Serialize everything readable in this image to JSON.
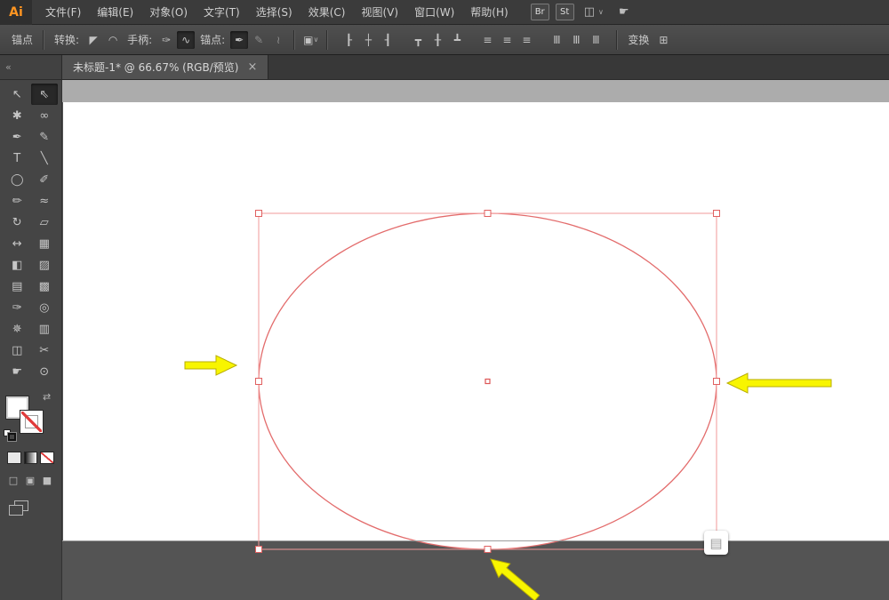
{
  "colors": {
    "arrow_yellow": "#f8f500",
    "selection_red": "#e36c6c",
    "bbox_pink": "#f29a9a",
    "artboard_bg": "#ffffff",
    "pasteboard_top": "#acacac",
    "pasteboard_bottom": "#545454",
    "ui_menubar": "#3b3b3b",
    "ui_controlbar": "#484848",
    "ui_toolbar": "#454545",
    "logo_orange": "#ff9521"
  },
  "app": {
    "logo": "Ai",
    "menus": [
      "文件(F)",
      "编辑(E)",
      "对象(O)",
      "文字(T)",
      "选择(S)",
      "效果(C)",
      "视图(V)",
      "窗口(W)",
      "帮助(H)"
    ],
    "badges": [
      "Br",
      "St"
    ],
    "workspace_glyph": "◫",
    "chevron_glyph": "∨",
    "hand_glyph": "☛"
  },
  "control": {
    "tool_label": "锚点",
    "convert_label": "转换:",
    "convert_icons": [
      "◤",
      "◠"
    ],
    "handles_label": "手柄:",
    "handle_icons": [
      "✑",
      "∿"
    ],
    "anchors_label": "锚点:",
    "anchor_icons": [
      "✒",
      "✎",
      "≀"
    ],
    "artboard_glyph": "▣",
    "align_icons": [
      "┠",
      "┼",
      "┨",
      "┳",
      "╂",
      "┻",
      "≡",
      "≡",
      "≡",
      "Ⅲ",
      "Ⅲ",
      "Ⅲ"
    ],
    "transform_label": "变换",
    "constrain_glyph": "⊞"
  },
  "tabbar": {
    "collapse_glyph": "«",
    "tab_title": "未标题-1* @ 66.67% (RGB/预览)",
    "close_glyph": "×"
  },
  "toolbar": {
    "tools": [
      {
        "name": "selection-tool",
        "glyph": "↖"
      },
      {
        "name": "direct-selection-tool",
        "glyph": "⇖"
      },
      {
        "name": "magic-wand-tool",
        "glyph": "✱"
      },
      {
        "name": "lasso-tool",
        "glyph": "∞"
      },
      {
        "name": "pen-tool",
        "glyph": "✒"
      },
      {
        "name": "curvature-tool",
        "glyph": "✎"
      },
      {
        "name": "type-tool",
        "glyph": "T"
      },
      {
        "name": "line-segment-tool",
        "glyph": "╲"
      },
      {
        "name": "ellipse-tool",
        "glyph": "◯"
      },
      {
        "name": "paintbrush-tool",
        "glyph": "✐"
      },
      {
        "name": "pencil-tool",
        "glyph": "✏"
      },
      {
        "name": "blob-brush-tool",
        "glyph": "≈"
      },
      {
        "name": "rotate-tool",
        "glyph": "↻"
      },
      {
        "name": "scale-tool",
        "glyph": "▱"
      },
      {
        "name": "width-tool",
        "glyph": "↔"
      },
      {
        "name": "free-transform-tool",
        "glyph": "▦"
      },
      {
        "name": "shape-builder-tool",
        "glyph": "◧"
      },
      {
        "name": "perspective-grid-tool",
        "glyph": "▨"
      },
      {
        "name": "mesh-tool",
        "glyph": "▤"
      },
      {
        "name": "gradient-tool",
        "glyph": "▩"
      },
      {
        "name": "eyedropper-tool",
        "glyph": "✑"
      },
      {
        "name": "blend-tool",
        "glyph": "◎"
      },
      {
        "name": "symbol-sprayer-tool",
        "glyph": "✵"
      },
      {
        "name": "column-graph-tool",
        "glyph": "▥"
      },
      {
        "name": "artboard-tool",
        "glyph": "◫"
      },
      {
        "name": "slice-tool",
        "glyph": "✂"
      },
      {
        "name": "hand-tool",
        "glyph": "☛"
      },
      {
        "name": "zoom-tool",
        "glyph": "⊙"
      }
    ],
    "swap_glyph": "⇄",
    "screen_mode_glyphs": [
      "□",
      "▣",
      "■"
    ],
    "artboard_badge_glyph": "▤"
  }
}
